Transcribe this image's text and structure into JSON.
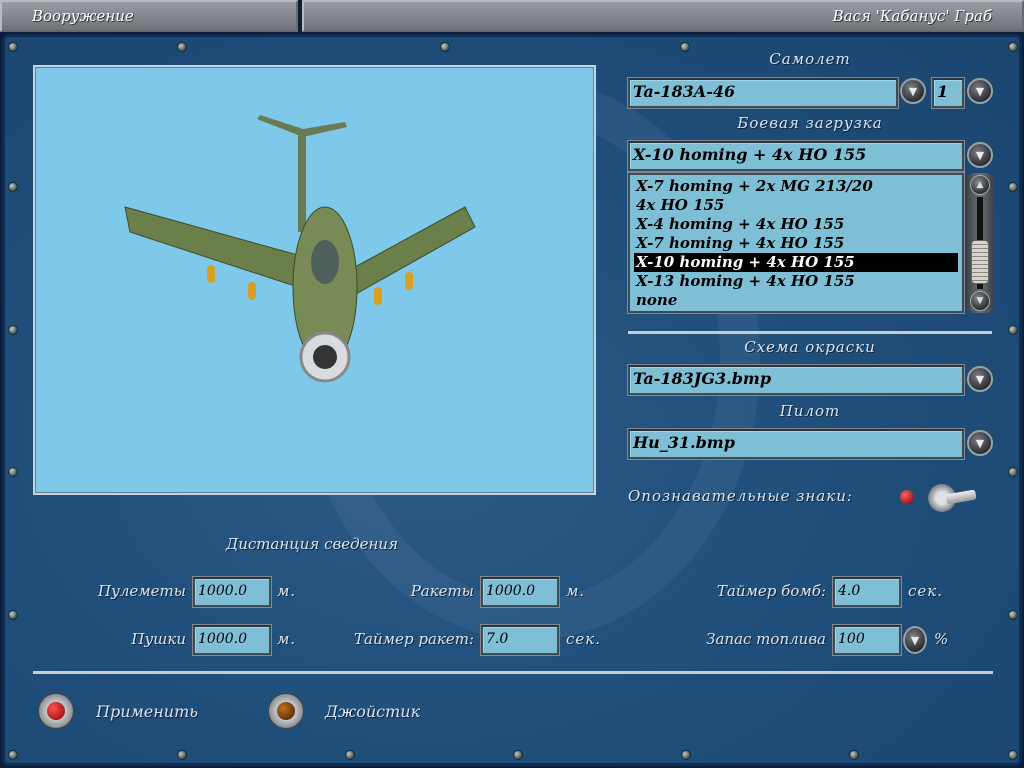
{
  "titlebar": {
    "section": "Вооружение",
    "player": "Вася 'Кабанус' Граб"
  },
  "aircraft": {
    "label": "Самолет",
    "value": "Ta-183A-46",
    "count": "1"
  },
  "loadout": {
    "label": "Боевая загрузка",
    "value": "X-10 homing + 4x HO 155",
    "options": [
      "X-7 homing + 2x MG 213/20",
      "4x HO 155",
      "X-4 homing + 4x HO 155",
      "X-7 homing + 4x HO 155",
      "X-10 homing + 4x HO 155",
      "X-13 homing + 4x HO 155",
      "none"
    ],
    "selected_index": 4
  },
  "skin": {
    "label": "Схема окраски",
    "value": "Ta-183JG3.bmp"
  },
  "pilot": {
    "label": "Пилот",
    "value": "Hu_31.bmp"
  },
  "markings": {
    "label": "Опознавательные знаки:"
  },
  "convergence": {
    "title": "Дистанция сведения",
    "mg_label": "Пулеметы",
    "mg_value": "1000.0",
    "mg_unit": "м.",
    "cannon_label": "Пушки",
    "cannon_value": "1000.0",
    "cannon_unit": "м.",
    "rocket_label": "Ракеты",
    "rocket_value": "1000.0",
    "rocket_unit": "м.",
    "rocket_timer_label": "Таймер ракет:",
    "rocket_timer_value": "7.0",
    "rocket_timer_unit": "сек.",
    "bomb_timer_label": "Таймер бомб:",
    "bomb_timer_value": "4.0",
    "bomb_timer_unit": "сек.",
    "fuel_label": "Запас топлива",
    "fuel_value": "100",
    "fuel_unit": "%"
  },
  "buttons": {
    "apply": "Применить",
    "joystick": "Джойстик"
  }
}
